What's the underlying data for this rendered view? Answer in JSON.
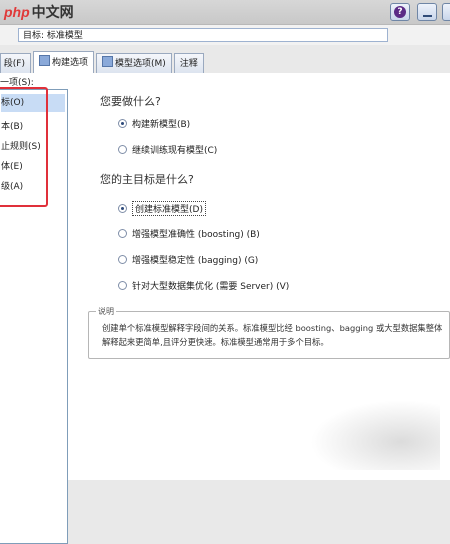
{
  "watermark": {
    "php": "php",
    "cn": "中文网"
  },
  "window": {
    "help_label": "?"
  },
  "target_field": {
    "text": "目标: 标准模型"
  },
  "tabs": [
    {
      "label": "段(F)"
    },
    {
      "label": "构建选项"
    },
    {
      "label": "模型选项(M)"
    },
    {
      "label": "注释"
    }
  ],
  "left_panel": {
    "caption": "一项(S):",
    "items": [
      {
        "label": "标(O)",
        "selected": true
      },
      {
        "label": "本(B)"
      },
      {
        "label": "止规则(S)"
      },
      {
        "label": "体(E)"
      },
      {
        "label": "级(A)"
      }
    ]
  },
  "section1": {
    "title": "您要做什么?",
    "options": [
      {
        "label": "构建新模型(B)",
        "checked": true
      },
      {
        "label": "继续训练现有模型(C)",
        "checked": false
      }
    ]
  },
  "section2": {
    "title": "您的主目标是什么?",
    "options": [
      {
        "label": "创建标准模型(D)",
        "checked": true
      },
      {
        "label": "增强模型准确性 (boosting) (B)",
        "checked": false
      },
      {
        "label": "增强模型稳定性 (bagging) (G)",
        "checked": false
      },
      {
        "label": "针对大型数据集优化 (需要 Server) (V)",
        "checked": false
      }
    ]
  },
  "description": {
    "legend": "说明",
    "text": "创建单个标准模型解释字段间的关系。标准模型比经 boosting、bagging 或大型数据集整体解释起来更简单,且评分更快速。标准模型通常用于多个目标。"
  },
  "colors": {
    "highlight_box": "#e0303a",
    "selected_row": "#c8dcf5"
  }
}
